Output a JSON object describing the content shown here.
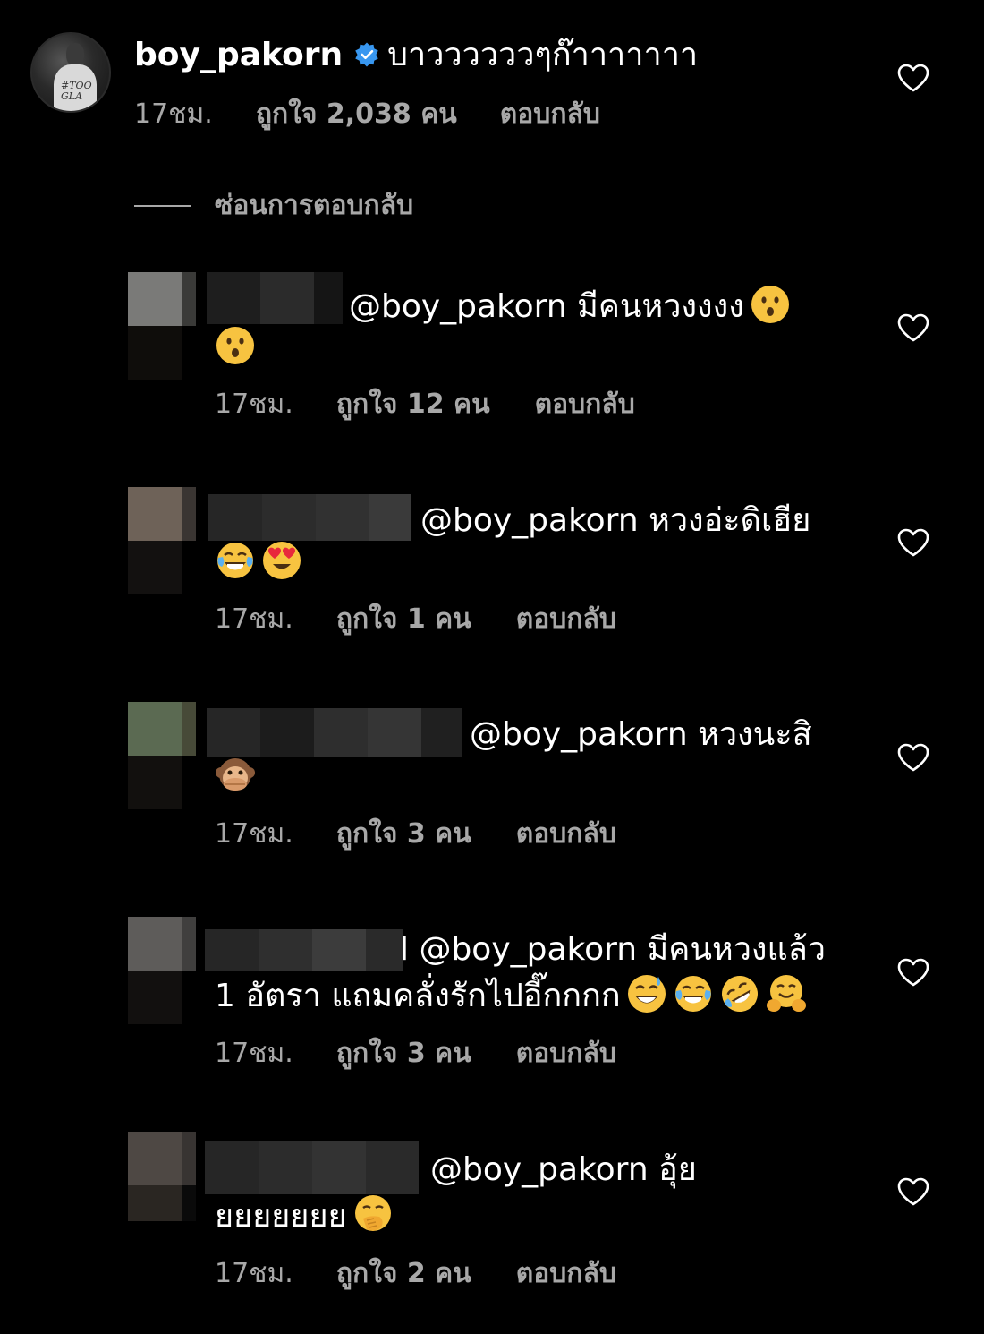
{
  "top_comment": {
    "username": "boy_pakorn",
    "text": "บาววววววๆก๊าาาาาาา",
    "time": "17ชม.",
    "likes": "ถูกใจ 2,038 คน",
    "reply": "ตอบกลับ",
    "avatar_shirt_text": "#TOO GLA"
  },
  "hide_replies": "ซ่อนการตอบกลับ",
  "replies": [
    {
      "line1": "@boy_pakorn มีคนหวงงงง",
      "line2": "",
      "emojis_line1": [
        "hushed-face"
      ],
      "emojis_line2": [
        "hushed-face"
      ],
      "time": "17ชม.",
      "likes": "ถูกใจ 12 คน",
      "reply": "ตอบกลับ"
    },
    {
      "line1": "@boy_pakorn หวงอ่ะดิเฮีย",
      "line2": "",
      "emojis_line2": [
        "tears-of-joy",
        "heart-eyes"
      ],
      "time": "17ชม.",
      "likes": "ถูกใจ 1 คน",
      "reply": "ตอบกลับ"
    },
    {
      "line1": "@boy_pakorn หวงนะสิ",
      "line2": "",
      "emojis_line2": [
        "speak-no-evil-monkey"
      ],
      "time": "17ชม.",
      "likes": "ถูกใจ 3 คน",
      "reply": "ตอบกลับ"
    },
    {
      "line1": "l @boy_pakorn มีคนหวงแล้ว",
      "line2": "1 อัตรา แถมคลั่งรักไปอี๊กกกก",
      "emojis_line2": [
        "grinning-sweat",
        "tears-of-joy",
        "rolling-laughing",
        "hugging-face"
      ],
      "time": "17ชม.",
      "likes": "ถูกใจ 3 คน",
      "reply": "ตอบกลับ"
    },
    {
      "line1": "@boy_pakorn อุ้ย",
      "line2": "ยยยยยยย",
      "emojis_line2": [
        "face-with-hand-over-mouth"
      ],
      "time": "17ชม.",
      "likes": "ถูกใจ 2 คน",
      "reply": "ตอบกลับ"
    }
  ],
  "colors": {
    "background": "#000000",
    "text": "#ffffff",
    "meta": "#a8a8a8",
    "verified": "#3897f0"
  }
}
